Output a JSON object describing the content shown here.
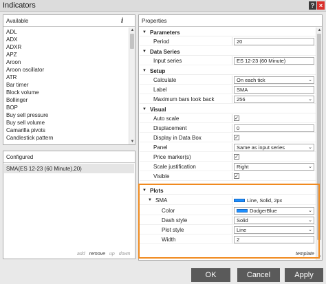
{
  "window": {
    "title": "Indicators",
    "help_label": "?",
    "close_label": "×"
  },
  "available": {
    "header": "Available",
    "info_label": "i",
    "items": [
      "ADL",
      "ADX",
      "ADXR",
      "APZ",
      "Aroon",
      "Aroon oscillator",
      "ATR",
      "Bar timer",
      "Block volume",
      "Bollinger",
      "BOP",
      "Buy sell pressure",
      "Buy sell volume",
      "Camarilla pivots",
      "Candlestick pattern"
    ]
  },
  "configured": {
    "header": "Configured",
    "items": [
      "SMA(ES 12-23 (60 Minute),20)"
    ],
    "actions": {
      "add": "add",
      "remove": "remove",
      "up": "up",
      "down": "down"
    }
  },
  "properties": {
    "header": "Properties",
    "sections": {
      "parameters": {
        "name": "Parameters",
        "period_label": "Period",
        "period_value": "20"
      },
      "data_series": {
        "name": "Data Series",
        "input_label": "Input series",
        "input_value": "ES 12-23 (60 Minute)"
      },
      "setup": {
        "name": "Setup",
        "calculate_label": "Calculate",
        "calculate_value": "On each tick",
        "label_label": "Label",
        "label_value": "SMA",
        "max_bars_label": "Maximum bars look back",
        "max_bars_value": "256"
      },
      "visual": {
        "name": "Visual",
        "auto_scale_label": "Auto scale",
        "displacement_label": "Displacement",
        "displacement_value": "0",
        "display_data_box_label": "Display in Data Box",
        "panel_label": "Panel",
        "panel_value": "Same as input series",
        "price_markers_label": "Price marker(s)",
        "scale_just_label": "Scale justification",
        "scale_just_value": "Right",
        "visible_label": "Visible"
      },
      "plots": {
        "name": "Plots",
        "sma_label": "SMA",
        "sma_summary": "Line, Solid, 2px",
        "color_label": "Color",
        "color_value": "DodgerBlue",
        "color_hex": "#1e90ff",
        "dash_label": "Dash style",
        "dash_value": "Solid",
        "plot_style_label": "Plot style",
        "plot_style_value": "Line",
        "width_label": "Width",
        "width_value": "2"
      }
    },
    "template_link": "template",
    "check_mark": "✓"
  },
  "buttons": {
    "ok": "OK",
    "cancel": "Cancel",
    "apply": "Apply"
  },
  "colors": {
    "highlight": "#f08a1f",
    "button": "#5a5a5a"
  }
}
